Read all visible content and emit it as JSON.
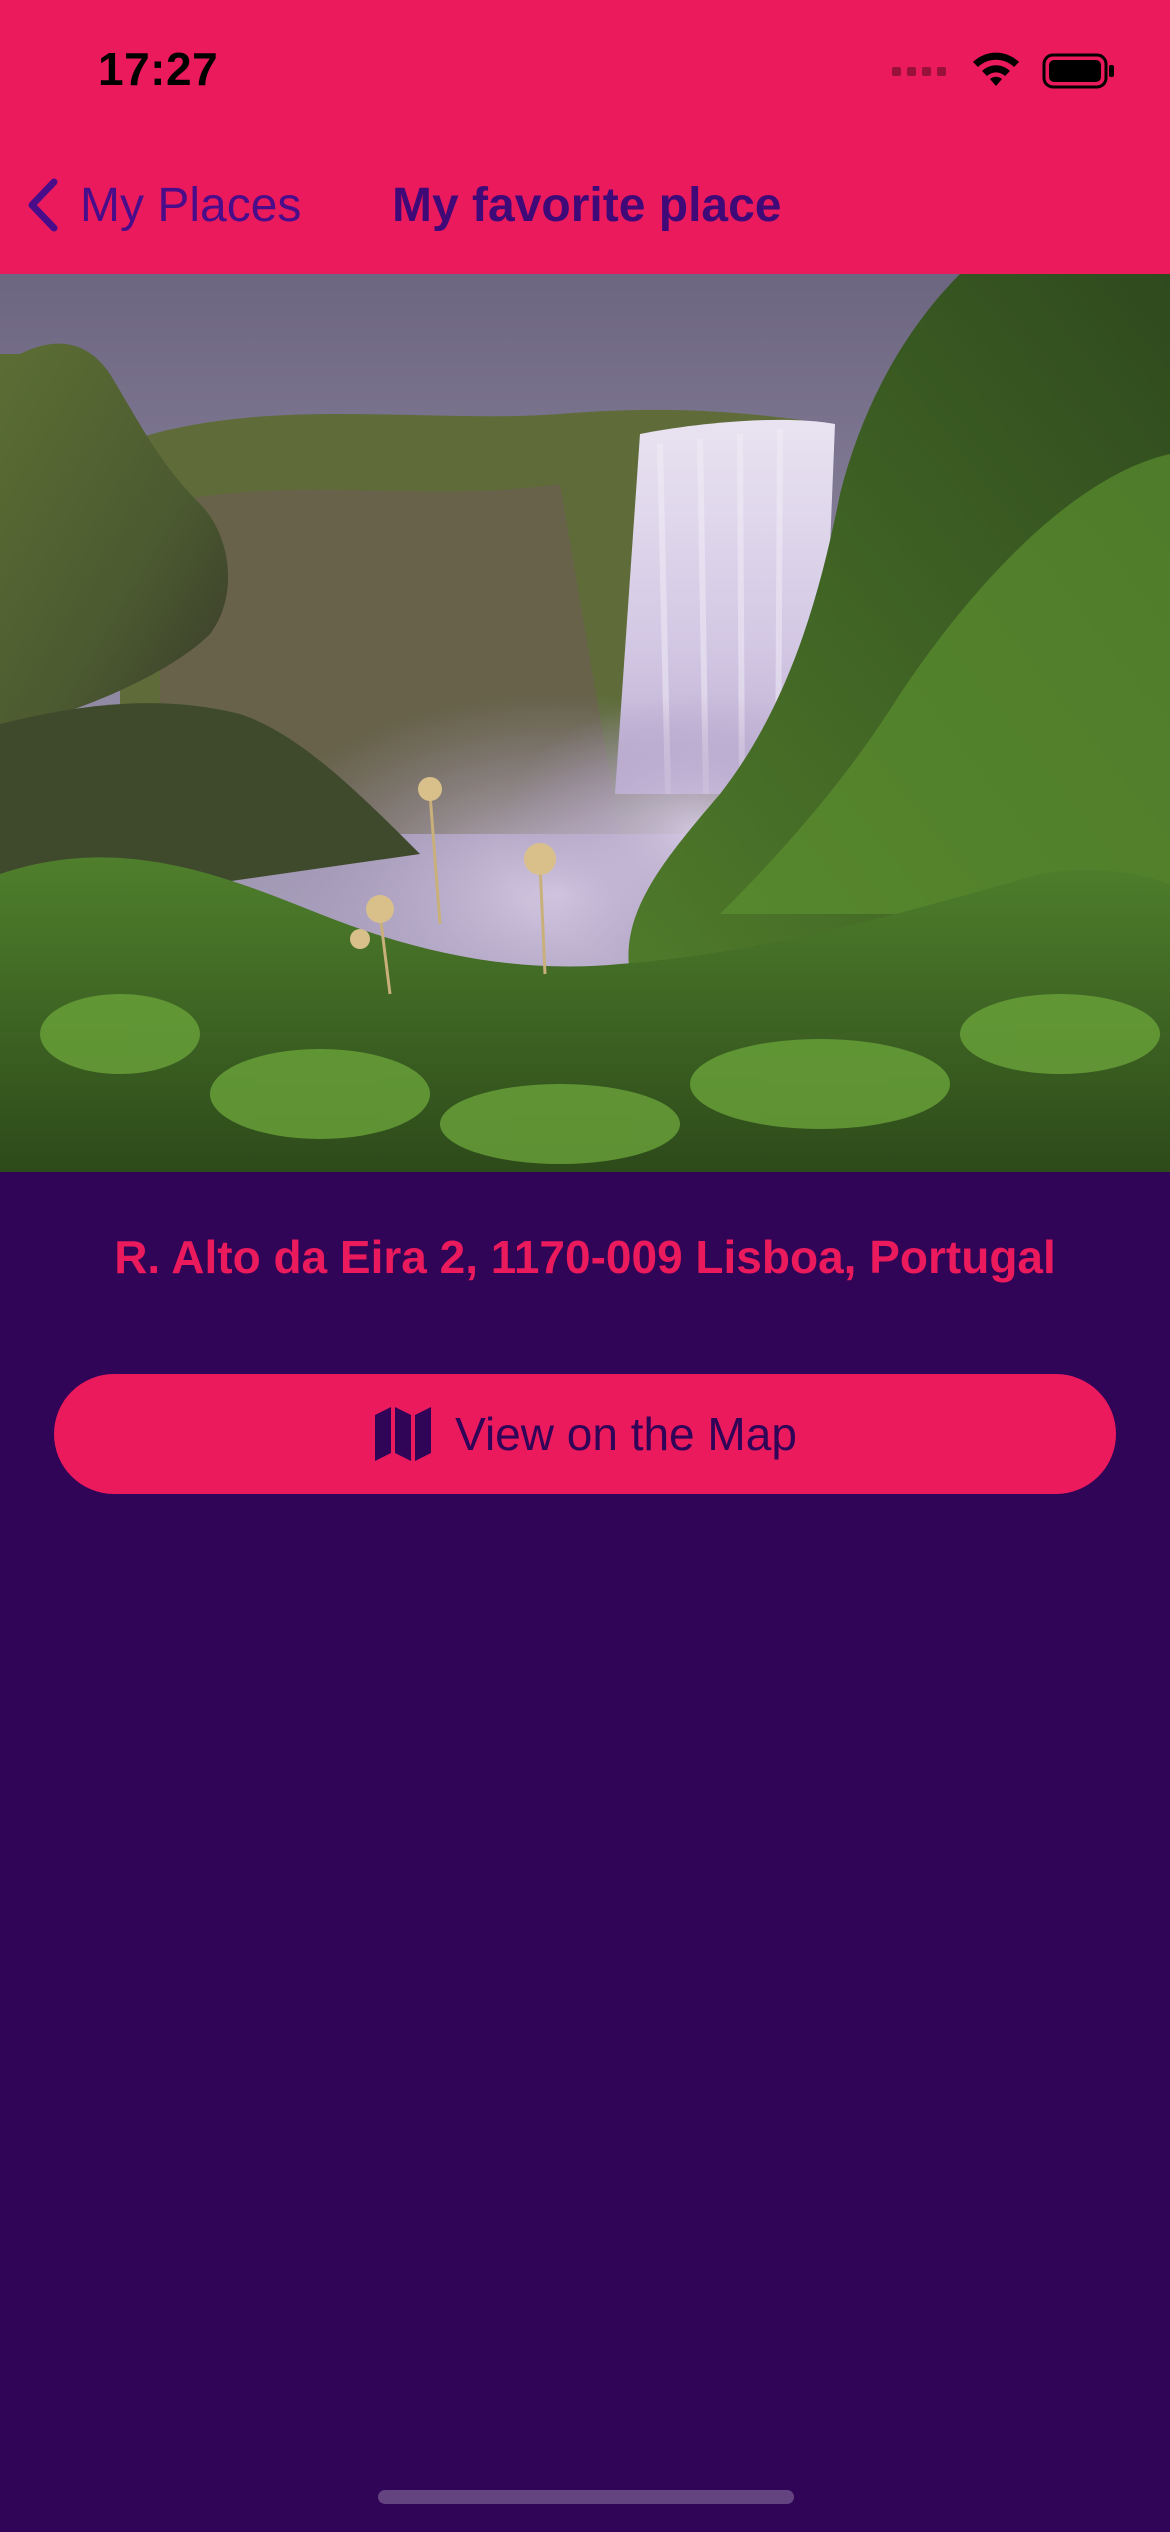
{
  "status_bar": {
    "time": "17:27"
  },
  "nav": {
    "back_label": "My Places",
    "title": "My favorite place"
  },
  "place": {
    "address": "R. Alto da Eira 2, 1170-009 Lisboa, Portugal"
  },
  "actions": {
    "map_button_label": "View on the Map",
    "map_button_icon": "map-icon"
  },
  "colors": {
    "accent": "#ea1a5d",
    "background": "#300457",
    "nav_text": "#4a0d8a"
  }
}
